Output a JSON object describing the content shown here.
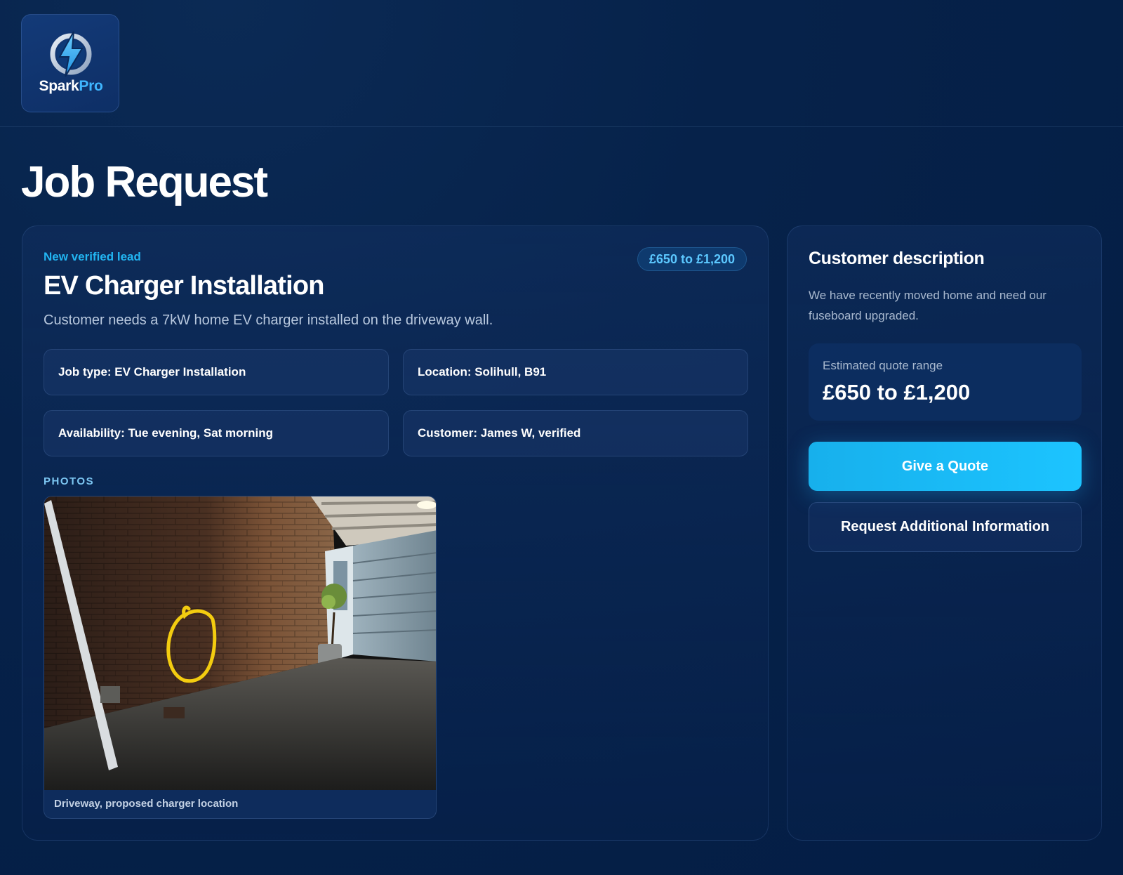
{
  "brand": {
    "name_part1": "Spark",
    "name_part2": "Pro",
    "logo_icon": "lightning-bolt-icon",
    "accent": "#22b5f2"
  },
  "page": {
    "title": "Job Request"
  },
  "job": {
    "lead_label": "New verified lead",
    "price_badge": "£650 to £1,200",
    "title": "EV Charger Installation",
    "summary": "Customer needs a 7kW home EV charger installed on the driveway wall.",
    "details": [
      "Job type: EV Charger Installation",
      "Location: Solihull, B91",
      "Availability: Tue evening, Sat morning",
      "Customer: James W, verified"
    ],
    "photos_label": "PHOTOS",
    "photos": [
      {
        "caption": "Driveway, proposed charger location"
      }
    ]
  },
  "sidebar": {
    "title": "Customer description",
    "description": "We have recently moved home and need our fuseboard upgraded.",
    "estimate_label": "Estimated quote range",
    "estimate_value": "£650 to £1,200",
    "primary_button": "Give a Quote",
    "secondary_button": "Request Additional Information"
  }
}
